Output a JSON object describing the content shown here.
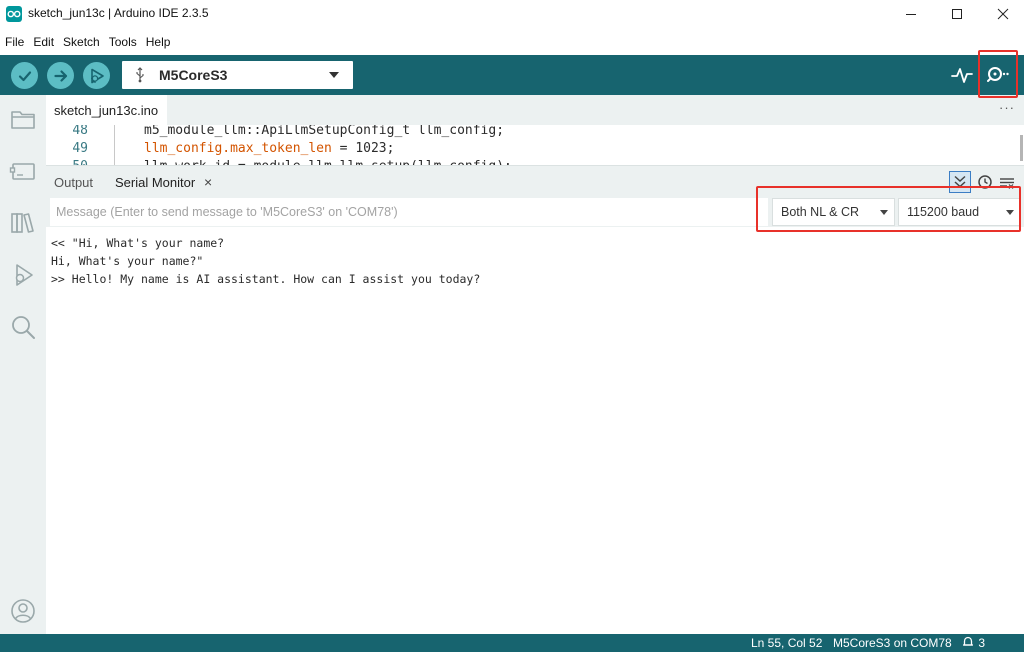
{
  "window": {
    "title": "sketch_jun13c | Arduino IDE 2.3.5"
  },
  "menu": [
    "File",
    "Edit",
    "Sketch",
    "Tools",
    "Help"
  ],
  "toolbar": {
    "board": "M5CoreS3"
  },
  "editor": {
    "tab": "sketch_jun13c.ino",
    "more": "···",
    "lines": [
      {
        "num": "48",
        "code": "m5_module_llm::ApiLlmSetupConfig_t llm_config;"
      },
      {
        "num": "49",
        "code_pre": "llm_config.max_token_len",
        "code_eq": " = ",
        "code_num": "1023",
        "code_post": ";"
      },
      {
        "num": "50",
        "code": "llm_work_id = module_llm.llm.setup(llm_config);"
      }
    ]
  },
  "panel": {
    "tabs": {
      "output": "Output",
      "serial": "Serial Monitor",
      "close": "×"
    }
  },
  "serial": {
    "placeholder": "Message (Enter to send message to 'M5CoreS3' on 'COM78')",
    "line_ending": "Both NL & CR",
    "baud": "115200 baud",
    "lines": [
      "<< \"Hi, What's your name?",
      "Hi, What's your name?\"",
      ">> Hello! My name is AI assistant. How can I assist you today?"
    ]
  },
  "status": {
    "position": "Ln 55, Col 52",
    "board_port": "M5CoreS3 on COM78",
    "notifications": "3"
  },
  "colors": {
    "toolbar": "#17646f",
    "button": "#5cbdc4",
    "sidebar": "#ecf1f1",
    "highlight": "#e8312a"
  }
}
